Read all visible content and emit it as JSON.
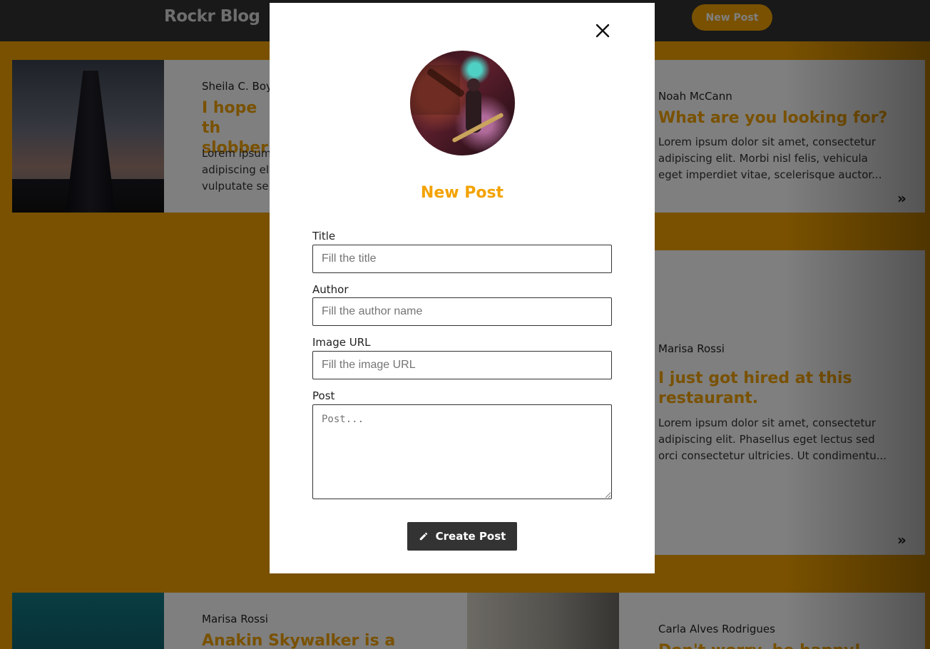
{
  "navbar": {
    "brand": "Rockr Blog",
    "new_post_label": "New Post"
  },
  "posts": [
    {
      "author": "Sheila C. Boy",
      "title": "I hope th slobber",
      "excerpt": "Lorem ipsum adipiscing eli vulputate ser"
    },
    {
      "author": "Noah McCann",
      "title": "What are you looking for?",
      "excerpt": "Lorem ipsum dolor sit amet, consectetur adipiscing elit. Morbi nisl felis, vehicula eget imperdiet vitae, scelerisque auctor..."
    },
    {
      "author": "Marisa Rossi",
      "title": "I just got hired at this restaurant.",
      "excerpt": "Lorem ipsum dolor sit amet, consectetur adipiscing elit. Phasellus eget lectus sed orci consectetur ultricies. Ut condimentu..."
    },
    {
      "author": "Marisa Rossi",
      "title": "Anakin Skywalker is a",
      "excerpt": ""
    },
    {
      "author": "Carla Alves Rodrigues",
      "title": "Don't worry, be happy!",
      "excerpt": ""
    }
  ],
  "modal": {
    "title": "New Post",
    "fields": {
      "title": {
        "label": "Title",
        "placeholder": "Fill the title"
      },
      "author": {
        "label": "Author",
        "placeholder": "Fill the author name"
      },
      "image_url": {
        "label": "Image URL",
        "placeholder": "Fill the image URL"
      },
      "post": {
        "label": "Post",
        "placeholder": "Post..."
      }
    },
    "submit_label": "Create Post"
  },
  "icons": {
    "close": "close-icon",
    "pencil": "pencil-icon",
    "more": "double-chevron-right-icon"
  },
  "colors": {
    "accent": "#f3a200",
    "navbar": "#333333",
    "button_dark": "#333333"
  }
}
